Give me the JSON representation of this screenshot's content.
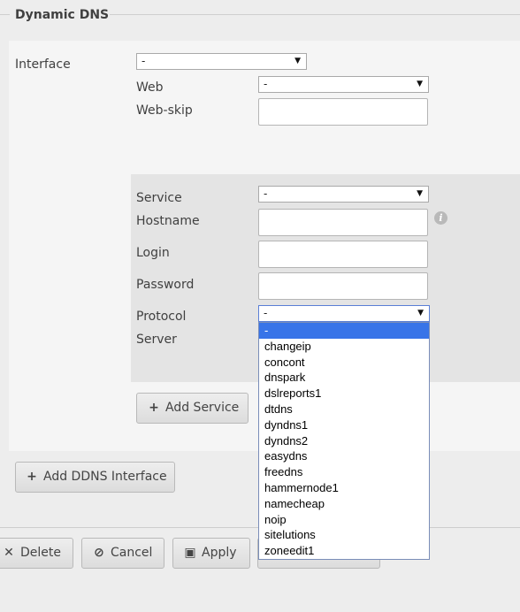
{
  "section": {
    "title": "Dynamic DNS"
  },
  "interface": {
    "label": "Interface",
    "value": "-",
    "web_label": "Web",
    "web_value": "-",
    "web_skip_label": "Web-skip",
    "web_skip_value": ""
  },
  "service": {
    "service_label": "Service",
    "service_value": "-",
    "hostname_label": "Hostname",
    "hostname_value": "",
    "login_label": "Login",
    "login_value": "",
    "password_label": "Password",
    "password_value": "",
    "protocol_label": "Protocol",
    "protocol_value": "-",
    "server_label": "Server",
    "info_icon_glyph": "i"
  },
  "protocol_options": [
    "-",
    "changeip",
    "concont",
    "dnspark",
    "dslreports1",
    "dtdns",
    "dyndns1",
    "dyndns2",
    "easydns",
    "freedns",
    "hammernode1",
    "namecheap",
    "noip",
    "sitelutions",
    "zoneedit1"
  ],
  "buttons": {
    "add_service": "Add Service",
    "add_ddns_interface": "Add DDNS Interface",
    "delete": "Delete",
    "cancel": "Cancel",
    "apply": "Apply"
  },
  "icons": {
    "add_service": "plus-icon",
    "add_ddns_interface": "plus-icon",
    "delete": "x-icon",
    "cancel": "ban-icon",
    "apply": "save-icon",
    "hostname_info": "info-icon",
    "select_arrow": "chevron-down-icon"
  },
  "colors": {
    "selected_option": "#3874e8",
    "background": "#ededed",
    "panel": "#f5f5f5",
    "service_panel": "#e4e4e4"
  }
}
